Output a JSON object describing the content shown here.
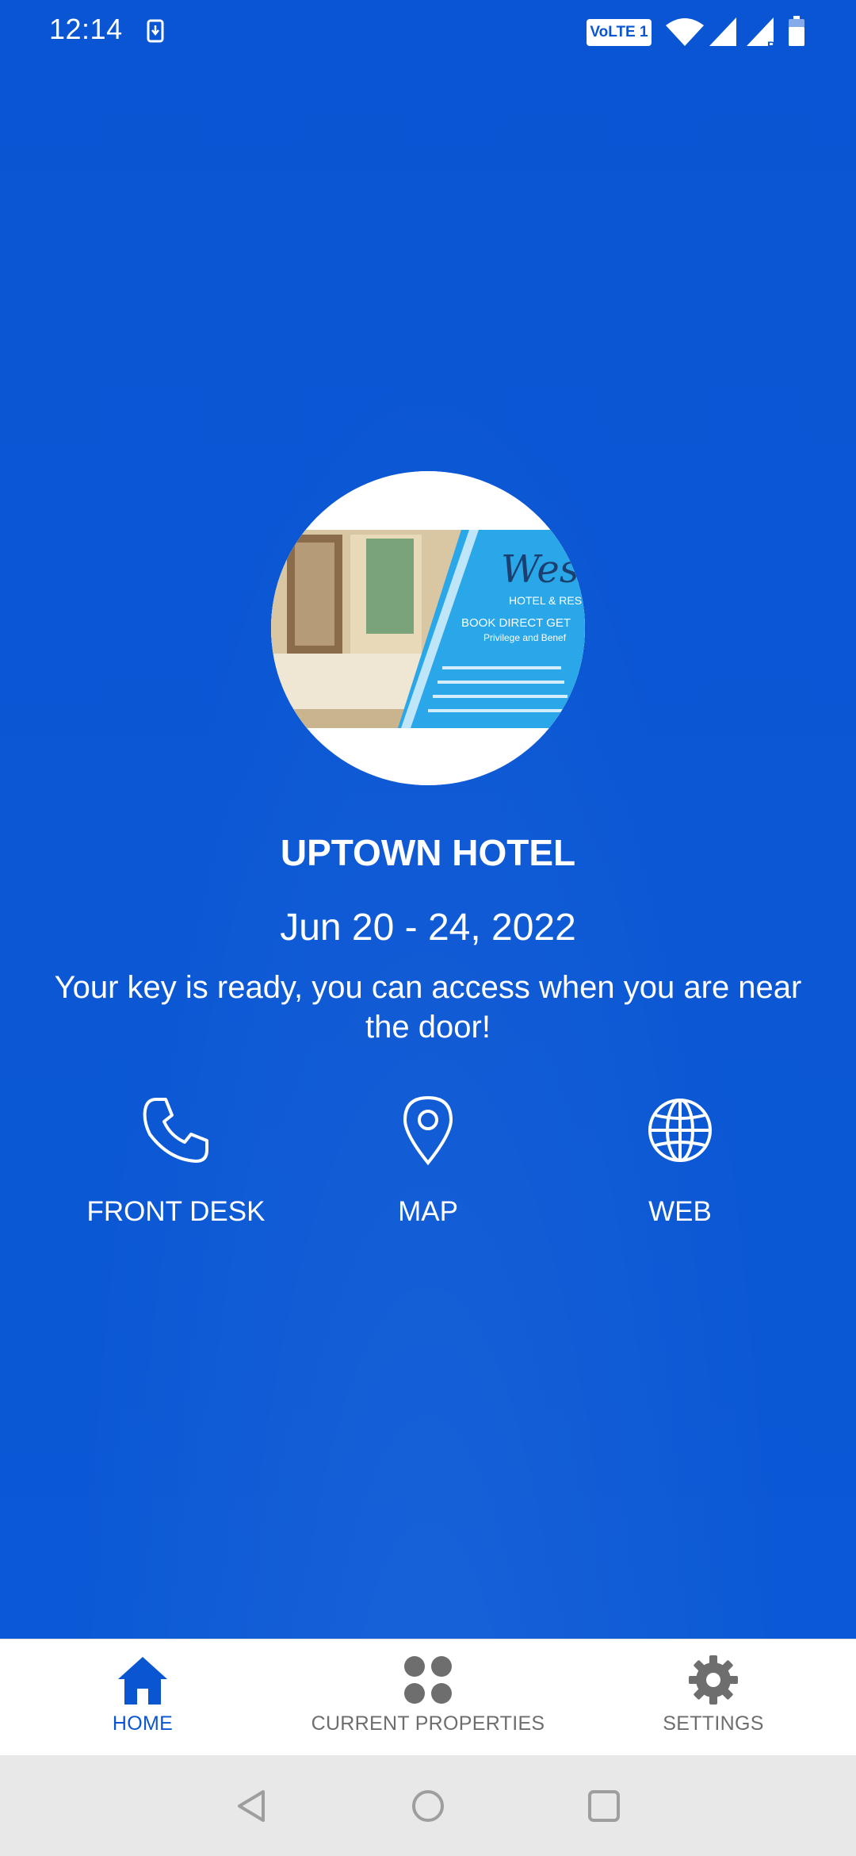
{
  "status_bar": {
    "time": "12:14",
    "network_badge": "VoLTE 1",
    "icons": [
      "download-icon",
      "wifi-icon",
      "signal-icon",
      "signal-roaming-icon",
      "battery-icon"
    ]
  },
  "hotel": {
    "image_icon": "hotel-photo",
    "name": "UPTOWN HOTEL",
    "dates": "Jun 20 - 24, 2022",
    "message": "Your key is ready, you can access when you are near the door!"
  },
  "actions": [
    {
      "label": "FRONT DESK",
      "icon": "phone-icon"
    },
    {
      "label": "MAP",
      "icon": "map-pin-icon"
    },
    {
      "label": "WEB",
      "icon": "globe-icon"
    }
  ],
  "bottom_nav": {
    "items": [
      {
        "label": "HOME",
        "icon": "home-icon",
        "active": true
      },
      {
        "label": "CURRENT PROPERTIES",
        "icon": "grid-icon",
        "active": false
      },
      {
        "label": "SETTINGS",
        "icon": "gear-icon",
        "active": false
      }
    ]
  },
  "system_nav": [
    "back-icon",
    "home-circle-icon",
    "recent-apps-icon"
  ],
  "colors": {
    "primary": "#0a56d2",
    "inactive": "#6e6e6e",
    "nav_background": "#ffffff",
    "system_background": "#e8e8e8"
  }
}
